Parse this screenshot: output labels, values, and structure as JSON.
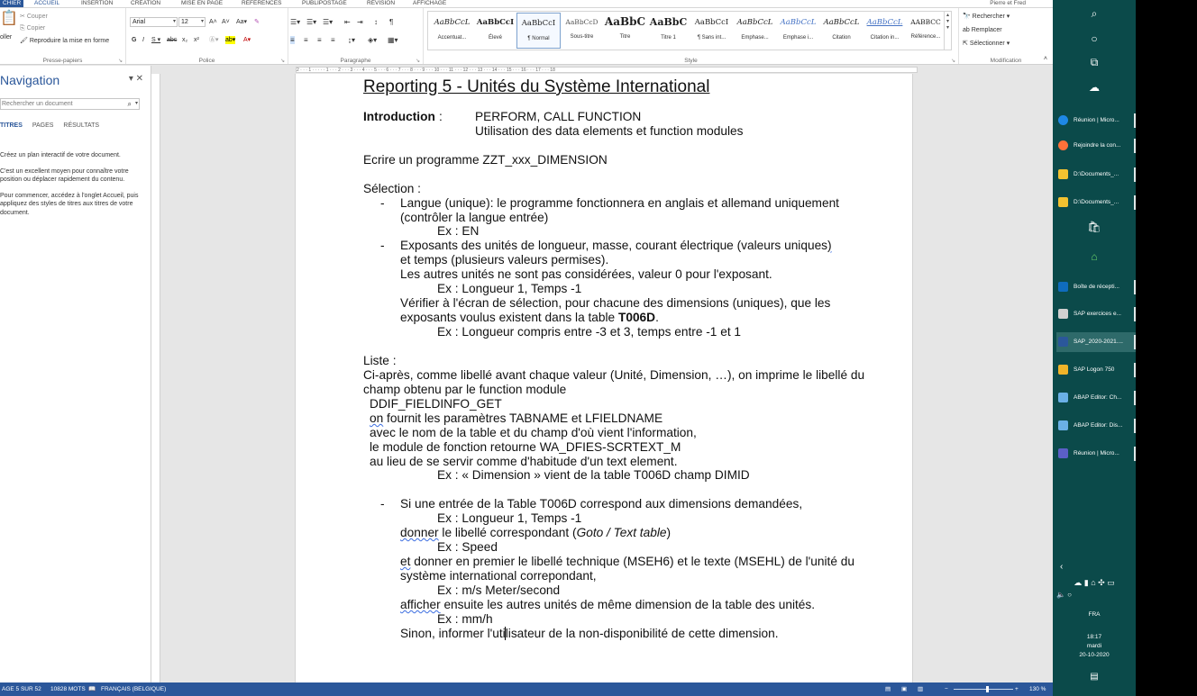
{
  "ribbon": {
    "tabs": [
      "CHIER",
      "ACCUEIL",
      "INSERTION",
      "CRÉATION",
      "MISE EN PAGE",
      "RÉFÉRENCES",
      "PUBLIPOSTAGE",
      "RÉVISION",
      "AFFICHAGE"
    ],
    "user": "Pierre et Fred",
    "clipboard": {
      "cut": "Couper",
      "copy": "Copier",
      "paste": "oller",
      "painter": "Reproduire la mise en forme",
      "group": "Presse-papiers"
    },
    "font": {
      "name": "Arial",
      "size": "12",
      "group": "Police"
    },
    "paragraph": {
      "group": "Paragraphe"
    },
    "styles": {
      "group": "Style",
      "items": [
        {
          "sample": "AaBbCcL",
          "name": "Accentuat..."
        },
        {
          "sample": "AaBbCcI",
          "name": "Élevé"
        },
        {
          "sample": "AaBbCcI",
          "name": "¶ Normal"
        },
        {
          "sample": "AaBbCcD",
          "name": "Sous-titre"
        },
        {
          "sample": "AaBbC",
          "name": "Titre"
        },
        {
          "sample": "AaBbC",
          "name": "Titre 1"
        },
        {
          "sample": "AaBbCcI",
          "name": "¶ Sans int..."
        },
        {
          "sample": "AaBbCcL",
          "name": "Emphase..."
        },
        {
          "sample": "AaBbCcL",
          "name": "Emphase i..."
        },
        {
          "sample": "AaBbCcL",
          "name": "Citation"
        },
        {
          "sample": "AaBbCcL",
          "name": "Citation in..."
        },
        {
          "sample": "AaBbCcL",
          "name": "Référence..."
        },
        {
          "sample": "AABBCC",
          "name": ""
        }
      ]
    },
    "editing": {
      "find": "Rechercher",
      "replace": "Remplacer",
      "select": "Sélectionner",
      "group": "Modification"
    }
  },
  "nav": {
    "title": "Navigation",
    "search_placeholder": "Rechercher un document",
    "tabs": [
      "TITRES",
      "PAGES",
      "RÉSULTATS"
    ],
    "help": [
      "Créez un plan interactif de votre document.",
      "C'est un excellent moyen pour connaître votre position ou déplacer rapidement du contenu.",
      "Pour commencer, accédez à l'onglet Accueil, puis appliquez des styles de titres aux titres de votre document."
    ]
  },
  "ruler": "2 · · · 1 · · · · · 1 · · · 2 · · · 3 · · · 4 · · · 5 · · · 6 · · · 7 · · · 8 · · · 9 · · · 10 · · · 11 · · · 12 · · · 13 · · · 14 · · · 15 · · · 16 · · · 17 · · · 18",
  "doc": {
    "title": "Reporting 5 - Unités du Système International",
    "intro_label": "Introduction",
    "intro_colon": ":",
    "intro_1": "PERFORM, CALL FUNCTION",
    "intro_2": "Utilisation des data elements et function modules",
    "program": "Ecrire un programme ZZT_xxx_DIMENSION",
    "selection": "Sélection :",
    "s1a": "Langue (unique): le programme fonctionnera en anglais et allemand uniquement",
    "s1b": "(contrôler la langue entrée)",
    "s1c": "Ex : EN",
    "s2a_pre": "Exposants des unités de longueur, masse, courant électrique (valeurs uniques",
    "s2a_post": ")",
    "s2b": "et temps (plusieurs valeurs permises).",
    "s2c": "Les autres unités ne sont pas considérées, valeur 0 pour l'exposant.",
    "s2d": "Ex : Longueur 1, Temps -1",
    "s2e": "Vérifier à l'écran de sélection, pour chacune des dimensions (uniques), que les",
    "s2f_pre": "exposants voulus existent dans la table ",
    "s2f_bold": "T006D",
    "s2f_post": ".",
    "s2g": "Ex : Longueur compris entre -3 et 3, temps entre -1 et 1",
    "liste": "Liste :",
    "l1": "Ci-après, comme libellé avant chaque valeur (Unité, Dimension, …), on imprime le libellé du",
    "l2": "champ obtenu par le function module",
    "l3": "DDIF_FIELDINFO_GET",
    "l4_sq": "on",
    "l4": " fournit les paramètres TABNAME et LFIELDNAME",
    "l5": "avec le nom de la table et du champ d'où vient l'information,",
    "l6": "le module de fonction retourne WA_DFIES-SCRTEXT_M",
    "l7": "au lieu de se servir comme d'habitude d'un text element.",
    "l8": "Ex : « Dimension » vient de la table T006D champ DIMID",
    "d1": "Si une entrée de la Table T006D correspond aux dimensions demandées,",
    "d2": "Ex : Longueur 1, Temps -1",
    "d3_sq": "donner",
    "d3": " le libellé correspondant (",
    "d3_it": "Goto / Text table",
    "d3_end": ")",
    "d4": "Ex : Speed",
    "d5_sq": "et",
    "d5": " donner en premier le libellé technique (MSEH6) et le texte (MSEHL) de l'unité du",
    "d6": "système international correpondant,",
    "d7": "Ex : m/s Meter/second",
    "d8_sq": "afficher",
    "d8": " ensuite les autres unités de même dimension de la table des unités.",
    "d9": "Ex : mm/h",
    "d10_pre": "Sinon, informer l'uti",
    "d10_post": "lisateur de la non-disponibilité de cette dimension."
  },
  "status": {
    "page": "AGE 5 SUR 52",
    "words": "10828 MOTS",
    "lang": "FRANÇAIS (BELGIQUE)",
    "zoom": "130 %"
  },
  "taskbar": {
    "apps": [
      {
        "label": "Réunion | Micro...",
        "color": "#1e88e5",
        "active": false
      },
      {
        "label": "Rejoindre la con...",
        "color": "#ff7139",
        "active": false
      },
      {
        "label": "D:\\Documents_...",
        "color": "#f2c230",
        "active": false
      },
      {
        "label": "D:\\Documents_...",
        "color": "#f2c230",
        "active": false
      },
      {
        "label": "Boîte de récepti...",
        "color": "#0f6cbd",
        "active": false
      },
      {
        "label": "SAP exercices e...",
        "color": "#d0d0d0",
        "active": false
      },
      {
        "label": "SAP_2020-2021....",
        "color": "#2b579a",
        "active": true
      },
      {
        "label": "SAP Logon 750",
        "color": "#f0b429",
        "active": false
      },
      {
        "label": "ABAP Editor: Ch...",
        "color": "#6ab0e6",
        "active": false
      },
      {
        "label": "ABAP Editor: Dis...",
        "color": "#6ab0e6",
        "active": false
      },
      {
        "label": "Réunion | Micro...",
        "color": "#5b5fc7",
        "active": false
      }
    ],
    "lang": "FRA",
    "time": "18:17",
    "day": "mardi",
    "date": "20-10-2020"
  }
}
